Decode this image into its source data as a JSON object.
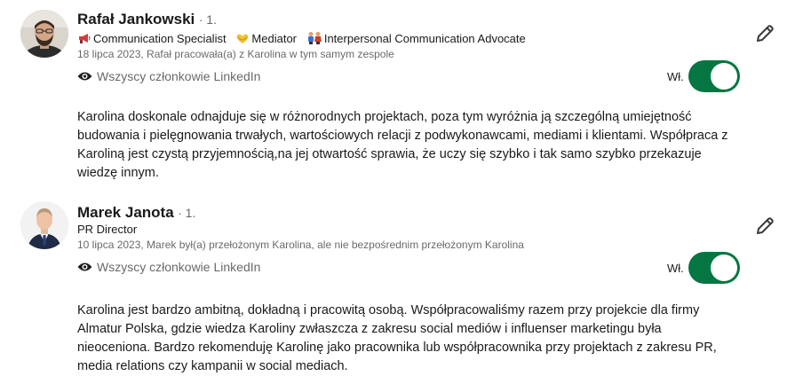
{
  "colors": {
    "toggle_on": "#057642",
    "primary_text": "#1f1f1f",
    "secondary_text": "#666666"
  },
  "recommendations": [
    {
      "name": "Rafał Jankowski",
      "degree": "· 1.",
      "headline_items": [
        {
          "icon": "megaphone-icon",
          "emoji": "📢",
          "text": "Communication Specialist"
        },
        {
          "icon": "heart-hands-icon",
          "emoji": "🫶",
          "text": "Mediator"
        },
        {
          "icon": "people-icon",
          "emoji": "👫",
          "text": "Interpersonal Communication Advocate"
        }
      ],
      "meta": "18 lipca 2023, Rafał pracowała(a) z Karolina w tym samym zespole",
      "visibility": "Wszyscy członkowie LinkedIn",
      "visibility_icon": "eye-icon",
      "toggle_label": "Wł.",
      "toggle_on": true,
      "edit_icon": "pencil-icon",
      "text": "Karolina doskonale odnajduje się w różnorodnych projektach, poza tym wyróżnia ją szczególną umiejętność budowania i pielęgnowania trwałych, wartościowych relacji z podwykonawcami, mediami i klientami. Współpraca z Karoliną jest czystą przyjemnością,na jej otwartość sprawia, że uczy się szybko i tak samo szybko przekazuje wiedzę innym."
    },
    {
      "name": "Marek Janota",
      "degree": "· 1.",
      "headline": "PR Director",
      "meta": "10 lipca 2023, Marek był(a) przełożonym Karolina, ale nie bezpośrednim przełożonym Karolina",
      "visibility": "Wszyscy członkowie LinkedIn",
      "visibility_icon": "eye-icon",
      "toggle_label": "Wł.",
      "toggle_on": true,
      "edit_icon": "pencil-icon",
      "text": "Karolina jest bardzo ambitną, dokładną i pracowitą osobą. Współpracowaliśmy razem przy projekcie dla firmy Almatur Polska, gdzie wiedza Karoliny zwłaszcza z zakresu social mediów i influenser marketingu była nieoceniona. Bardzo rekomenduję Karolinę jako pracownika lub współpracownika przy projektach z zakresu PR, media relations czy kampanii w social mediach."
    }
  ]
}
